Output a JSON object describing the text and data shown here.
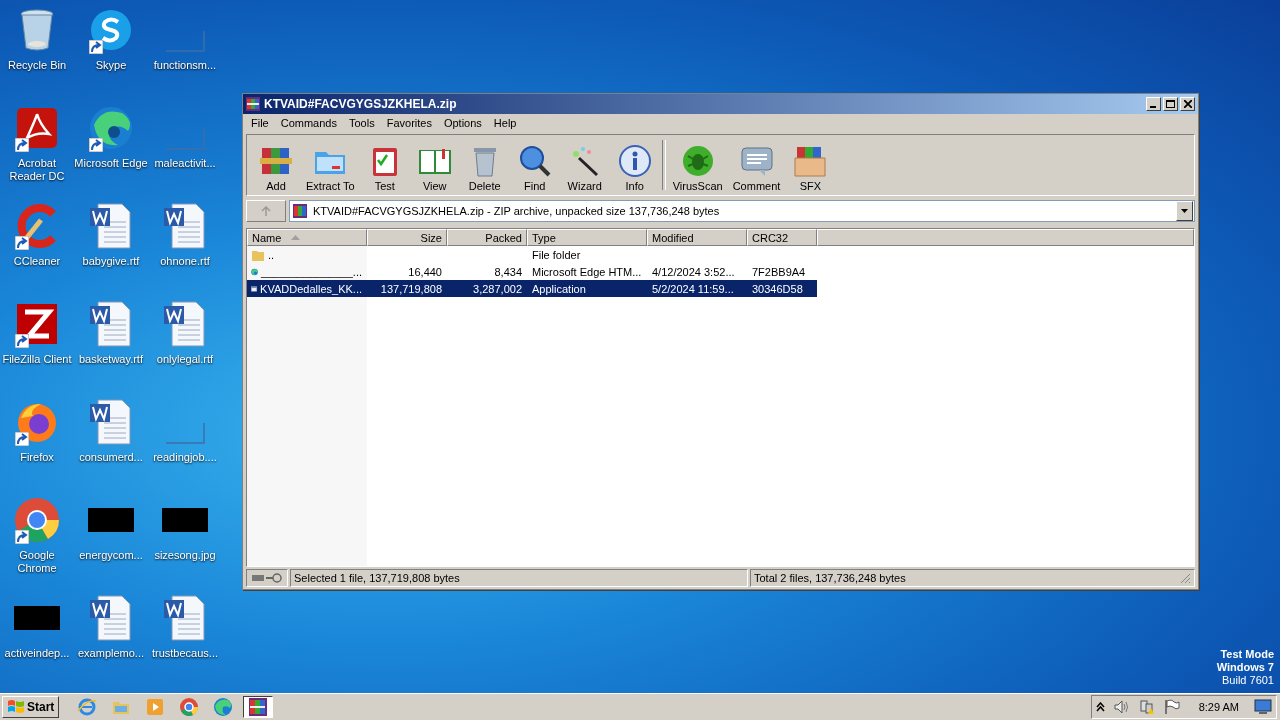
{
  "desktop_icons": [
    {
      "label": "Recycle Bin",
      "kind": "recycle",
      "shortcut": false
    },
    {
      "label": "Acrobat Reader DC",
      "kind": "acrobat",
      "shortcut": true
    },
    {
      "label": "CCleaner",
      "kind": "ccleaner",
      "shortcut": true
    },
    {
      "label": "FileZilla Client",
      "kind": "filezilla",
      "shortcut": true
    },
    {
      "label": "Firefox",
      "kind": "firefox",
      "shortcut": true
    },
    {
      "label": "Google Chrome",
      "kind": "chrome",
      "shortcut": true
    },
    {
      "label": "activeindep...",
      "kind": "black",
      "shortcut": false
    },
    {
      "label": "Skype",
      "kind": "skype",
      "shortcut": true
    },
    {
      "label": "Microsoft Edge",
      "kind": "edge",
      "shortcut": true
    },
    {
      "label": "babygive.rtf",
      "kind": "word",
      "shortcut": false
    },
    {
      "label": "basketway.rtf",
      "kind": "word",
      "shortcut": false
    },
    {
      "label": "consumerd...",
      "kind": "word",
      "shortcut": false
    },
    {
      "label": "energycom...",
      "kind": "black",
      "shortcut": false
    },
    {
      "label": "examplemo...",
      "kind": "word",
      "shortcut": false
    },
    {
      "label": "functionsm...",
      "kind": "blank",
      "shortcut": false
    },
    {
      "label": "maleactivit...",
      "kind": "blank",
      "shortcut": false
    },
    {
      "label": "ohnone.rtf",
      "kind": "word",
      "shortcut": false
    },
    {
      "label": "onlylegal.rtf",
      "kind": "word",
      "shortcut": false
    },
    {
      "label": "readingjob....",
      "kind": "blank",
      "shortcut": false
    },
    {
      "label": "sizesong.jpg",
      "kind": "black",
      "shortcut": false
    },
    {
      "label": "trustbecaus...",
      "kind": "word",
      "shortcut": false
    }
  ],
  "window": {
    "title": "KTVAID#FACVGYGSJZKHELA.zip",
    "menu": [
      "File",
      "Commands",
      "Tools",
      "Favorites",
      "Options",
      "Help"
    ],
    "toolbar_groups": [
      [
        {
          "label": "Add",
          "kind": "add"
        },
        {
          "label": "Extract To",
          "kind": "extract"
        },
        {
          "label": "Test",
          "kind": "test"
        },
        {
          "label": "View",
          "kind": "view"
        },
        {
          "label": "Delete",
          "kind": "delete"
        },
        {
          "label": "Find",
          "kind": "find"
        },
        {
          "label": "Wizard",
          "kind": "wizard"
        },
        {
          "label": "Info",
          "kind": "info"
        }
      ],
      [
        {
          "label": "VirusScan",
          "kind": "virus"
        },
        {
          "label": "Comment",
          "kind": "comment"
        },
        {
          "label": "SFX",
          "kind": "sfx"
        }
      ]
    ],
    "address": "KTVAID#FACVGYGSJZKHELA.zip - ZIP archive, unpacked size 137,736,248 bytes",
    "columns": [
      "Name",
      "Size",
      "Packed",
      "Type",
      "Modified",
      "CRC32"
    ],
    "rows": [
      {
        "kind": "folder",
        "selected": false,
        "name": "..",
        "type": "File folder"
      },
      {
        "kind": "edge",
        "selected": false,
        "name": "_______________...",
        "size": "16,440",
        "packed": "8,434",
        "type": "Microsoft Edge HTM...",
        "modified": "4/12/2024 3:52...",
        "crc32": "7F2BB9A4"
      },
      {
        "kind": "app",
        "selected": true,
        "name": "KVADDedalles_KK...",
        "size": "137,719,808",
        "packed": "3,287,002",
        "type": "Application",
        "modified": "5/2/2024 11:59...",
        "crc32": "30346D58"
      }
    ],
    "status_left": "Selected 1 file, 137,719,808 bytes",
    "status_right": "Total 2 files, 137,736,248 bytes"
  },
  "os_notice": [
    "Test Mode",
    "Windows 7",
    "Build 7601"
  ],
  "taskbar": {
    "start": "Start",
    "apps": [
      {
        "kind": "ie",
        "active": false
      },
      {
        "kind": "explorer",
        "active": false
      },
      {
        "kind": "media",
        "active": false
      },
      {
        "kind": "chrome",
        "active": false
      },
      {
        "kind": "edge",
        "active": false
      },
      {
        "kind": "winrar",
        "active": true
      }
    ],
    "clock": "8:29 AM"
  }
}
